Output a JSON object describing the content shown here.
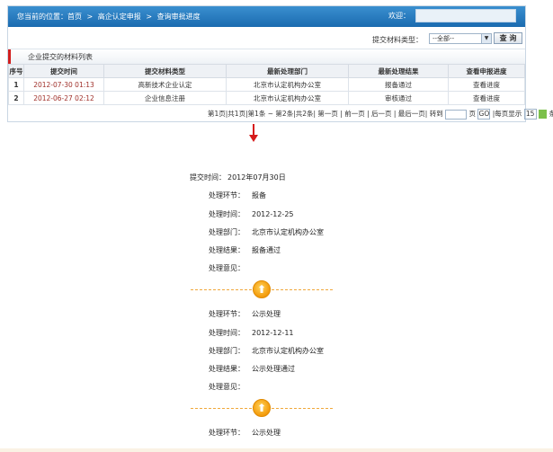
{
  "header": {
    "breadcrumb": [
      "您当前的位置：首页",
      ">",
      "高企认定申报",
      ">",
      "查询审批进度"
    ],
    "welcome_label": "欢迎："
  },
  "filter": {
    "label": "提交材料类型：",
    "selected": "--全部--",
    "query_button": "查 询"
  },
  "section_title": "企业提交的材料列表",
  "table": {
    "columns": [
      "序号",
      "提交时间",
      "提交材料类型",
      "最新处理部门",
      "最新处理结果",
      "查看申报进度"
    ],
    "rows": [
      [
        "1",
        "2012-07-30 01:13",
        "高新技术企业认定",
        "北京市认定机构办公室",
        "报备通过",
        "查看进度"
      ],
      [
        "2",
        "2012-06-27 02:12",
        "企业信息注册",
        "北京市认定机构办公室",
        "审核通过",
        "查看进度"
      ]
    ]
  },
  "pager": {
    "text_before": "第1页|共1页|第1条 ~ 第2条|共2条| 第一页 | 前一页 | 后一页 | 最后一页| 转到",
    "page_unit": "页",
    "go": "GO",
    "per_page_label": "|每页显示",
    "per_page_value": "15",
    "per_page_unit": "条"
  },
  "detail": {
    "submit_label": "提交时间：",
    "submit_value": "2012年07月30日",
    "steps": [
      {
        "step_label": "处理环节：",
        "step_value": "报备",
        "time_label": "处理时间：",
        "time_value": "2012-12-25",
        "dept_label": "处理部门：",
        "dept_value": "北京市认定机构办公室",
        "result_label": "处理结果：",
        "result_value": "报备通过",
        "opinion_label": "处理意见：",
        "opinion_value": ""
      },
      {
        "step_label": "处理环节：",
        "step_value": "公示处理",
        "time_label": "处理时间：",
        "time_value": "2012-12-11",
        "dept_label": "处理部门：",
        "dept_value": "北京市认定机构办公室",
        "result_label": "处理结果：",
        "result_value": "公示处理通过",
        "opinion_label": "处理意见：",
        "opinion_value": ""
      },
      {
        "step_label": "处理环节：",
        "step_value": "公示处理"
      }
    ],
    "up_arrow_glyph": "⬆"
  },
  "colors": {
    "topbar": "#1b6bb0",
    "accent_red": "#d61b1b",
    "date_text": "#a0302a",
    "separator": "#f0a83b"
  }
}
